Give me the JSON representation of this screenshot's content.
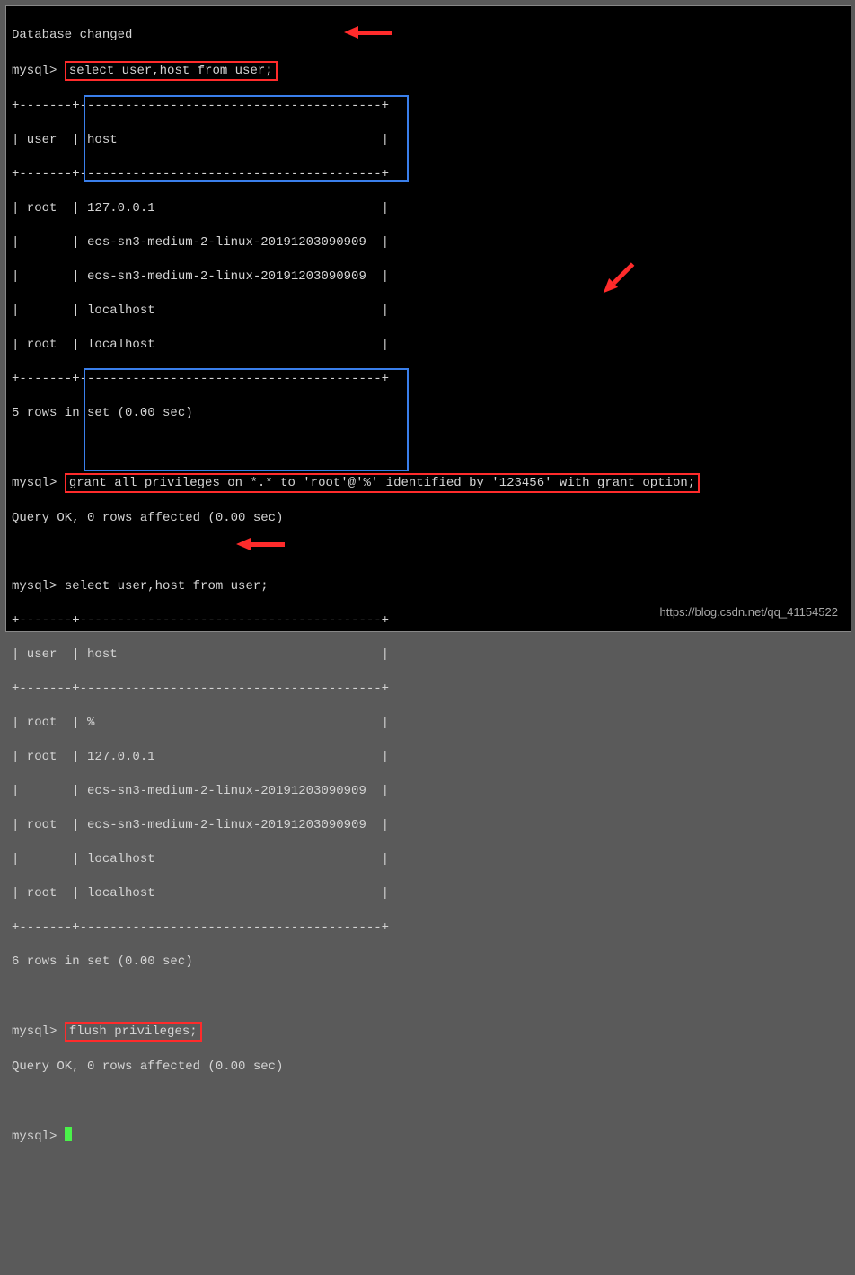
{
  "header": {
    "db_changed": "Database changed"
  },
  "prompt": "mysql>",
  "cmd1": "select user,host from user;",
  "table_border_top": "+-------+----------------------------------------+",
  "table_header": "| user  | host                                   |",
  "table1": {
    "rows": [
      {
        "l": "| root  | 127.0.0.1                              |"
      },
      {
        "l": "|       | ecs-sn3-medium-2-linux-20191203090909  |"
      },
      {
        "l": "|       | ecs-sn3-medium-2-linux-20191203090909  |"
      },
      {
        "l": "|       | localhost                              |"
      },
      {
        "l": "| root  | localhost                              |"
      }
    ],
    "summary": "5 rows in set (0.00 sec)"
  },
  "cmd2": "grant all privileges on *.* to 'root'@'%' identified by '123456' with grant option;",
  "ok_msg": "Query OK, 0 rows affected (0.00 sec)",
  "cmd3": "select user,host from user;",
  "table2": {
    "rows": [
      {
        "l": "| root  | %                                      |"
      },
      {
        "l": "| root  | 127.0.0.1                              |"
      },
      {
        "l": "|       | ecs-sn3-medium-2-linux-20191203090909  |"
      },
      {
        "l": "| root  | ecs-sn3-medium-2-linux-20191203090909  |"
      },
      {
        "l": "|       | localhost                              |"
      },
      {
        "l": "| root  | localhost                              |"
      }
    ],
    "summary": "6 rows in set (0.00 sec)"
  },
  "cmd4": "flush privileges;",
  "watermark": "https://blog.csdn.net/qq_41154522"
}
